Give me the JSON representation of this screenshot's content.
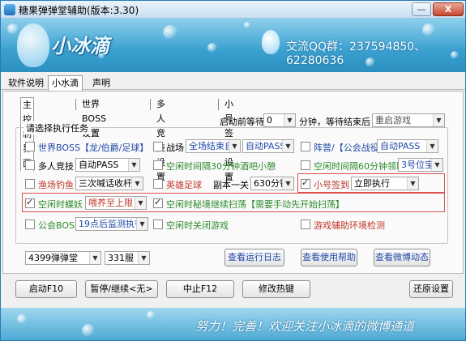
{
  "window": {
    "title": "糖果弹弹堂辅助(版本:3.30)",
    "min_label": "—",
    "close_label": "X"
  },
  "banner": {
    "logo_text": "小冰滴",
    "qq_text": "交流QQ群：237594850、62280636"
  },
  "menu_tabs": [
    "软件说明",
    "小水滴",
    "声明"
  ],
  "sub_tabs": [
    "主控制界面",
    "世界BOSS设置",
    "多人竞技设置",
    "小号签到设置"
  ],
  "top_controls": {
    "countdown_label": "启动前等待",
    "countdown_value": "0",
    "after_label": "分钟，等待结束后",
    "after_value": "重启游戏"
  },
  "group": {
    "label": "请选择执行任务"
  },
  "tasks": {
    "world_boss": {
      "label": "世界BOSS【龙/伯爵/足球】",
      "checked": false
    },
    "battle": {
      "label": "战场",
      "checked": false,
      "value1": "全场结束自",
      "value2": "自动PASS"
    },
    "faction": {
      "label": "阵营/【公会战役",
      "checked": false,
      "value": "自动PASS"
    },
    "multi": {
      "label": "多人竞技",
      "checked": false,
      "value": "自动PASS"
    },
    "idle30": {
      "label": "空闲时间隔30分钟酒吧小憩",
      "checked": false
    },
    "idle60": {
      "label": "空闲时间隔60分钟领取",
      "checked": false,
      "value": "3号位宝"
    },
    "fishing": {
      "label": "渔场钓鱼",
      "checked": false,
      "value": "三次喊话收杆"
    },
    "hero": {
      "label": "英雄足球",
      "checked": false
    },
    "dungeon": {
      "label": "副本一关",
      "value": "630分钟"
    },
    "alt_sign": {
      "label": "小号签到",
      "checked": true,
      "value": "立即执行"
    },
    "idle_pet": {
      "label": "空闲时蝶妖",
      "checked": true,
      "value": "喂养至上限"
    },
    "idle_sweep": {
      "label": "空闲时秘境继续扫荡【需要手动先开始扫荡】",
      "checked": true
    },
    "guild_boss": {
      "label": "公会BOSS",
      "checked": false,
      "value": "19点后监测执行"
    },
    "idle_close": {
      "label": "空闲时关闭游戏",
      "checked": false
    },
    "env_check": {
      "label": "游戏辅助环境检测",
      "checked": false
    }
  },
  "selectors": {
    "platform": "4399弹弹堂",
    "server": "331服"
  },
  "link_buttons": {
    "log": "查看运行日志",
    "help": "查看使用帮助",
    "weibo": "查看微博动态"
  },
  "bottom_buttons": {
    "start": "启动F10",
    "pause": "暂停/继续<无>",
    "stop": "中止F12",
    "hotkey": "修改热键",
    "reset": "还原设置"
  },
  "footer": {
    "text": "努力！完善！欢迎关注小冰滴的微博通道"
  },
  "colors": {
    "task_blue": "#1f48a8",
    "task_green": "#2c8a2c",
    "task_red": "#c0392b",
    "highlight_border": "#e05050",
    "banner": "#3aa0cf"
  }
}
